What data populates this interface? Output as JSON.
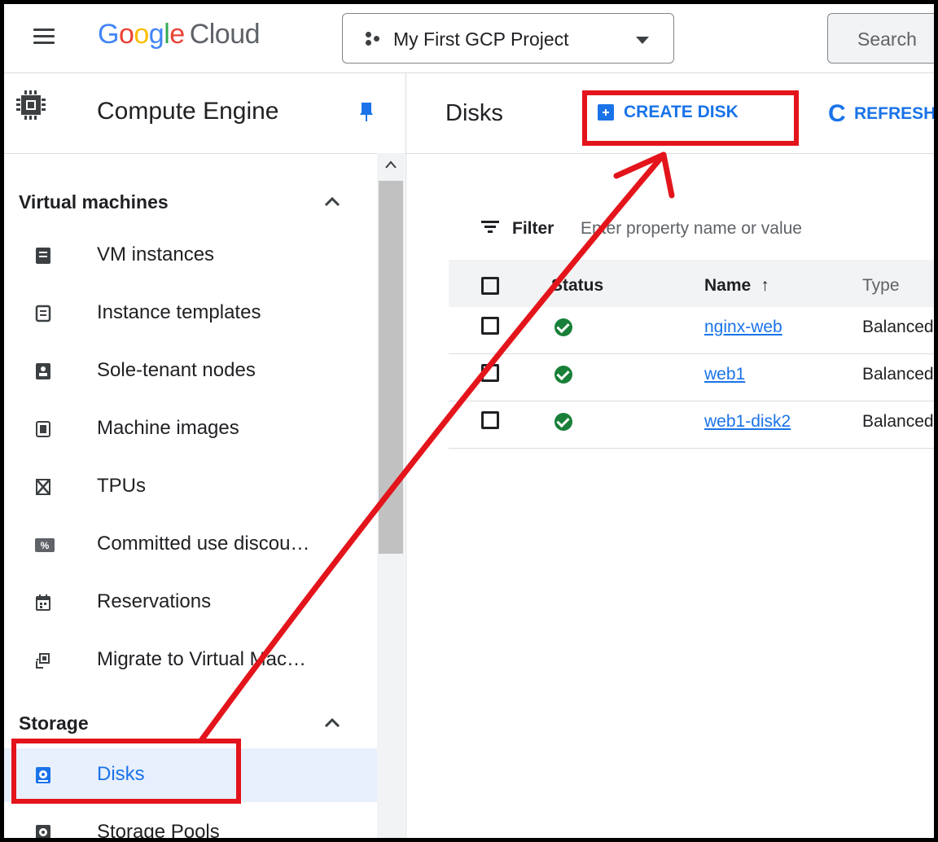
{
  "topbar": {
    "logo_letters": [
      "G",
      "o",
      "o",
      "g",
      "l",
      "e"
    ],
    "logo_cloud": "Cloud",
    "project_name": "My First GCP Project",
    "search_placeholder": "Search"
  },
  "sidebar": {
    "title": "Compute Engine",
    "sections": [
      {
        "label": "Virtual machines"
      },
      {
        "label": "Storage"
      }
    ],
    "items": [
      {
        "label": "VM instances",
        "icon": "vm-instance-icon"
      },
      {
        "label": "Instance templates",
        "icon": "instance-template-icon"
      },
      {
        "label": "Sole-tenant nodes",
        "icon": "sole-tenant-icon"
      },
      {
        "label": "Machine images",
        "icon": "machine-image-icon"
      },
      {
        "label": "TPUs",
        "icon": "tpu-icon"
      },
      {
        "label": "Committed use discou…",
        "icon": "percent-icon"
      },
      {
        "label": "Reservations",
        "icon": "calendar-icon"
      },
      {
        "label": "Migrate to Virtual Mac…",
        "icon": "migrate-icon"
      },
      {
        "label": "Disks",
        "icon": "disk-icon",
        "active": true
      },
      {
        "label": "Storage Pools",
        "icon": "storage-pool-icon"
      }
    ]
  },
  "main": {
    "title": "Disks",
    "create_label": "CREATE DISK",
    "refresh_label": "REFRESH",
    "refresh_glyph": "C",
    "filter_label": "Filter",
    "filter_placeholder": "Enter property name or value",
    "columns": {
      "status": "Status",
      "name": "Name",
      "sort_glyph": "↑",
      "type": "Type"
    },
    "rows": [
      {
        "name": "nginx-web",
        "type": "Balanced"
      },
      {
        "name": "web1",
        "type": "Balanced"
      },
      {
        "name": "web1-disk2",
        "type": "Balanced"
      }
    ]
  },
  "colors": {
    "accent": "#1a73e8",
    "annotation": "#e3141b",
    "status_ok": "#188038",
    "active_bg": "#e8f0fe"
  }
}
